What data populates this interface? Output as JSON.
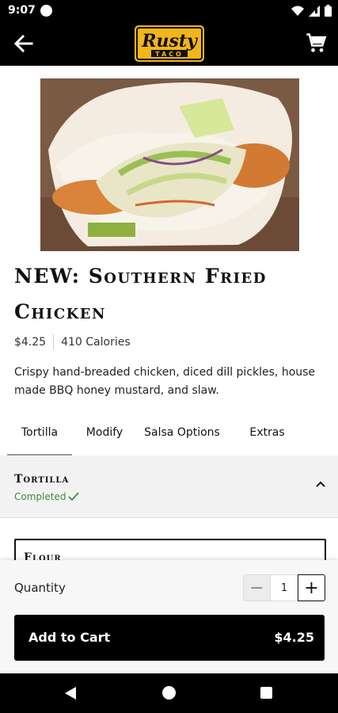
{
  "status_bar": {
    "time": "9:07"
  },
  "app_bar": {
    "logo_line1": "Rusty",
    "logo_line2": "TACO",
    "back_icon": "arrow-left-icon",
    "cart_icon": "cart-icon"
  },
  "product": {
    "title": "NEW: Southern Fried Chicken",
    "price": "$4.25",
    "calories": "410 Calories",
    "description": "Crispy hand-breaded chicken, diced dill pickles, house made BBQ honey mustard, and slaw."
  },
  "tabs": [
    {
      "label": "Tortilla"
    },
    {
      "label": "Modify"
    },
    {
      "label": "Salsa Options"
    },
    {
      "label": "Extras"
    }
  ],
  "section": {
    "title": "Tortilla",
    "status": "Completed"
  },
  "option": {
    "label": "Flour"
  },
  "quantity": {
    "label": "Quantity",
    "value": "1",
    "minus": "−",
    "plus": "+"
  },
  "cart_button": {
    "label": "Add to Cart",
    "price": "$4.25"
  },
  "colors": {
    "brand_yellow": "#f2b51b",
    "status_green": "#3d8c3d",
    "bar_black": "#000000"
  }
}
